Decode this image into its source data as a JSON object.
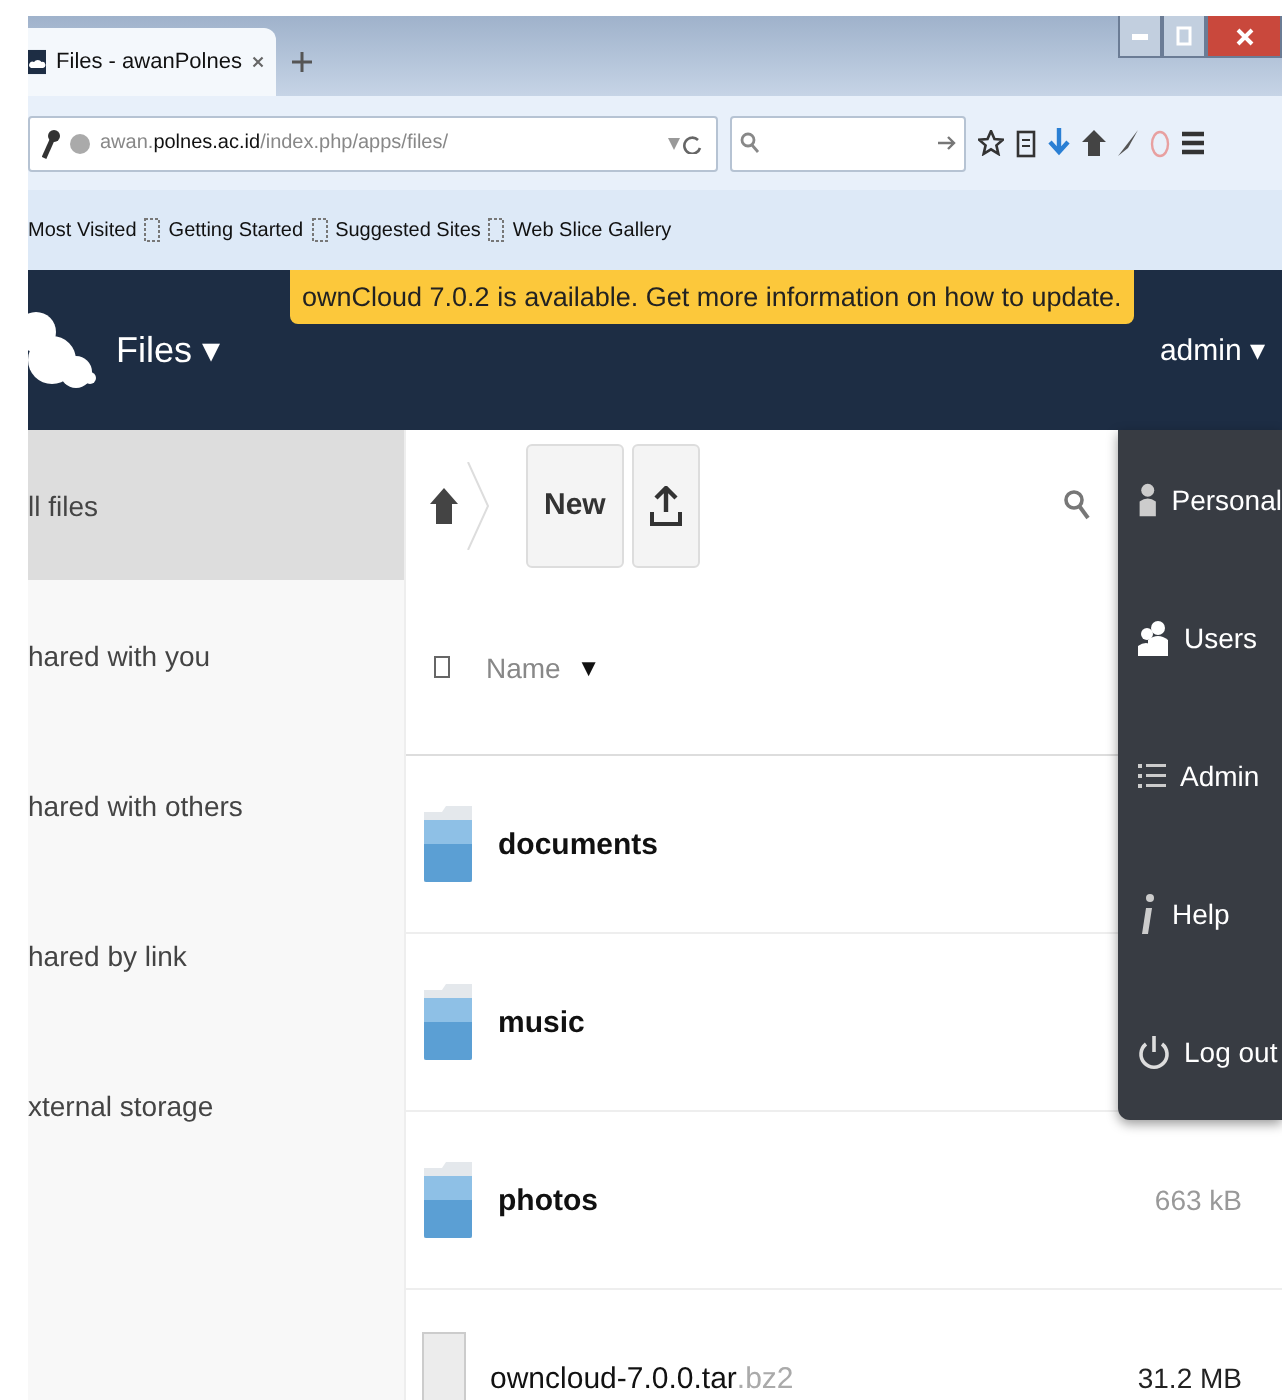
{
  "browser": {
    "tab_title": "Files - awanPolnes",
    "url": "awan.**polnes.ac.id**/index.php/apps/files/",
    "bookmarks": [
      {
        "label": "Most Visited",
        "has_icon": false
      },
      {
        "label": "Getting Started",
        "has_icon": true
      },
      {
        "label": "Suggested Sites",
        "has_icon": true
      },
      {
        "label": "Web Slice Gallery",
        "has_icon": true
      }
    ]
  },
  "header": {
    "app_menu": "Files ▾",
    "notice": "ownCloud 7.0.2 is available. Get more information on how to update.",
    "user_menu": "admin ▾"
  },
  "sidebar": {
    "items": [
      {
        "label": "ll files",
        "selected": true
      },
      {
        "label": "hared with you",
        "selected": false
      },
      {
        "label": "hared with others",
        "selected": false
      },
      {
        "label": "hared by link",
        "selected": false
      },
      {
        "label": "xternal storage",
        "selected": false
      }
    ]
  },
  "toolbar": {
    "new_button": "New"
  },
  "table": {
    "name_column": "Name",
    "sort_arrow": "▼",
    "rows": [
      {
        "kind": "folder",
        "name": "documents"
      },
      {
        "kind": "folder",
        "name": "music"
      },
      {
        "kind": "folder",
        "name": "photos",
        "size": "663 kB"
      },
      {
        "kind": "file",
        "name": "owncloud-7.0.0.tar",
        "extension": ".bz2",
        "size": "31.2 MB"
      }
    ]
  },
  "user_menu": {
    "items": [
      {
        "kind": "personal",
        "label": "Personal"
      },
      {
        "kind": "users",
        "label": "Users"
      },
      {
        "kind": "admin",
        "label": "Admin"
      },
      {
        "kind": "help",
        "label": "Help"
      },
      {
        "kind": "logout",
        "label": "Log out"
      }
    ]
  }
}
